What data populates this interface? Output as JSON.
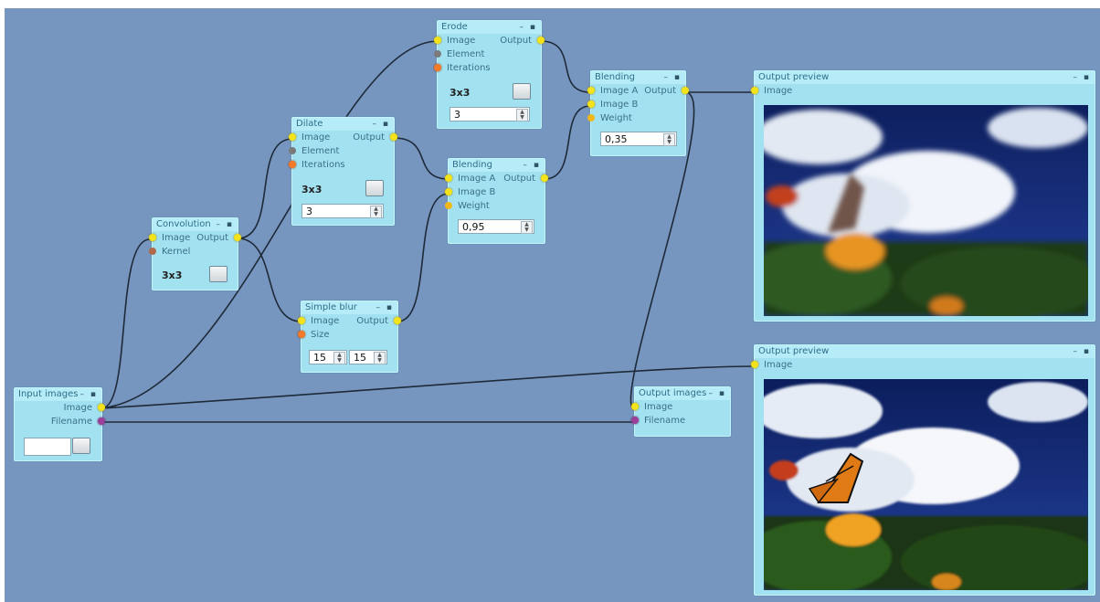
{
  "nodes": {
    "erode": {
      "title": "Erode",
      "in1": "Image",
      "in2": "Element",
      "in3": "Iterations",
      "out": "Output",
      "element": "3x3",
      "iterations": "3"
    },
    "dilate": {
      "title": "Dilate",
      "in1": "Image",
      "in2": "Element",
      "in3": "Iterations",
      "out": "Output",
      "element": "3x3",
      "iterations": "3"
    },
    "convolution": {
      "title": "Convolution",
      "in1": "Image",
      "in2": "Kernel",
      "out": "Output",
      "kernel": "3x3"
    },
    "blending1": {
      "title": "Blending",
      "in1": "Image A",
      "in2": "Image B",
      "in3": "Weight",
      "out": "Output",
      "weight": "0,95"
    },
    "blending2": {
      "title": "Blending",
      "in1": "Image A",
      "in2": "Image B",
      "in3": "Weight",
      "out": "Output",
      "weight": "0,35"
    },
    "simple_blur": {
      "title": "Simple blur",
      "in1": "Image",
      "in2": "Size",
      "out": "Output",
      "size_w": "15",
      "size_h": "15"
    },
    "input_images": {
      "title": "Input images",
      "out1": "Image",
      "out2": "Filename",
      "value": ""
    },
    "output_images": {
      "title": "Output images",
      "in1": "Image",
      "in2": "Filename"
    },
    "preview1": {
      "title": "Output preview",
      "in1": "Image"
    },
    "preview2": {
      "title": "Output preview",
      "in1": "Image"
    }
  },
  "header_controls": "– ▪",
  "colors": {
    "canvas": "#7696c0",
    "node": "#a2e2f0",
    "wire": "#1e2a38"
  },
  "icons": [
    "minimize-icon",
    "maximize-icon",
    "image-port-dot",
    "filename-port-dot"
  ]
}
